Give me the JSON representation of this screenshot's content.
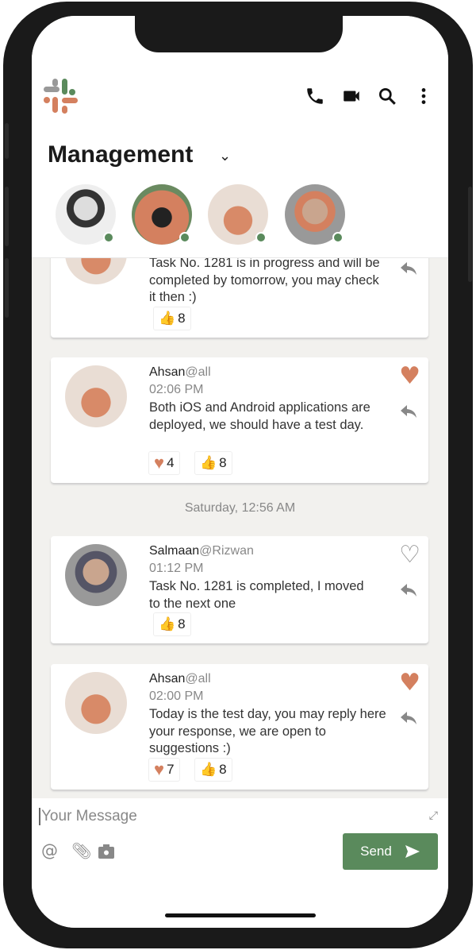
{
  "header": {
    "channel_title": "Management",
    "icons": [
      "phone-icon",
      "video-icon",
      "search-icon",
      "more-vertical-icon"
    ],
    "members_online": 4
  },
  "colors": {
    "accent": "#5a8a5c",
    "heart": "#d4805f",
    "background": "#f2f1ee"
  },
  "messages": [
    {
      "text": "Task No. 1281 is in progress and will be completed by tomorrow, you may check it then :)",
      "likes": "8"
    },
    {
      "name": "Ahsan",
      "mention": "@all",
      "time": "02:06 PM",
      "text": "Both iOS and Android applications are deployed, we should have a test day.",
      "hearts": "4",
      "likes": "8",
      "liked": true
    },
    {
      "name": "Salmaan",
      "mention": "@Rizwan",
      "time": "01:12 PM",
      "text": "Task No. 1281 is completed, I moved to the next one",
      "likes": "8",
      "liked": false
    },
    {
      "name": "Ahsan",
      "mention": "@all",
      "time": "02:00 PM",
      "text": "Today is the test day, you may reply here your response, we are open to suggestions :)",
      "hearts": "7",
      "likes": "8",
      "liked": true
    }
  ],
  "date_separator": "Saturday, 12:56 AM",
  "composer": {
    "placeholder": "Your Message",
    "send_label": "Send"
  }
}
